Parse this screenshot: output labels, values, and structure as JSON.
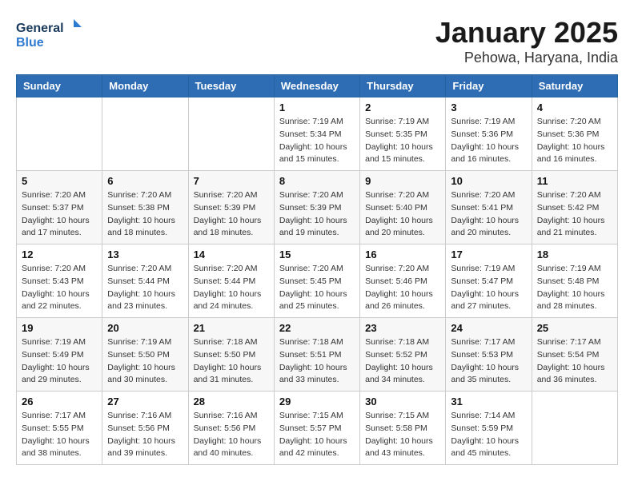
{
  "logo": {
    "line1": "General",
    "line2": "Blue"
  },
  "title": "January 2025",
  "location": "Pehowa, Haryana, India",
  "weekdays": [
    "Sunday",
    "Monday",
    "Tuesday",
    "Wednesday",
    "Thursday",
    "Friday",
    "Saturday"
  ],
  "weeks": [
    [
      {
        "day": "",
        "info": ""
      },
      {
        "day": "",
        "info": ""
      },
      {
        "day": "",
        "info": ""
      },
      {
        "day": "1",
        "info": "Sunrise: 7:19 AM\nSunset: 5:34 PM\nDaylight: 10 hours\nand 15 minutes."
      },
      {
        "day": "2",
        "info": "Sunrise: 7:19 AM\nSunset: 5:35 PM\nDaylight: 10 hours\nand 15 minutes."
      },
      {
        "day": "3",
        "info": "Sunrise: 7:19 AM\nSunset: 5:36 PM\nDaylight: 10 hours\nand 16 minutes."
      },
      {
        "day": "4",
        "info": "Sunrise: 7:20 AM\nSunset: 5:36 PM\nDaylight: 10 hours\nand 16 minutes."
      }
    ],
    [
      {
        "day": "5",
        "info": "Sunrise: 7:20 AM\nSunset: 5:37 PM\nDaylight: 10 hours\nand 17 minutes."
      },
      {
        "day": "6",
        "info": "Sunrise: 7:20 AM\nSunset: 5:38 PM\nDaylight: 10 hours\nand 18 minutes."
      },
      {
        "day": "7",
        "info": "Sunrise: 7:20 AM\nSunset: 5:39 PM\nDaylight: 10 hours\nand 18 minutes."
      },
      {
        "day": "8",
        "info": "Sunrise: 7:20 AM\nSunset: 5:39 PM\nDaylight: 10 hours\nand 19 minutes."
      },
      {
        "day": "9",
        "info": "Sunrise: 7:20 AM\nSunset: 5:40 PM\nDaylight: 10 hours\nand 20 minutes."
      },
      {
        "day": "10",
        "info": "Sunrise: 7:20 AM\nSunset: 5:41 PM\nDaylight: 10 hours\nand 20 minutes."
      },
      {
        "day": "11",
        "info": "Sunrise: 7:20 AM\nSunset: 5:42 PM\nDaylight: 10 hours\nand 21 minutes."
      }
    ],
    [
      {
        "day": "12",
        "info": "Sunrise: 7:20 AM\nSunset: 5:43 PM\nDaylight: 10 hours\nand 22 minutes."
      },
      {
        "day": "13",
        "info": "Sunrise: 7:20 AM\nSunset: 5:44 PM\nDaylight: 10 hours\nand 23 minutes."
      },
      {
        "day": "14",
        "info": "Sunrise: 7:20 AM\nSunset: 5:44 PM\nDaylight: 10 hours\nand 24 minutes."
      },
      {
        "day": "15",
        "info": "Sunrise: 7:20 AM\nSunset: 5:45 PM\nDaylight: 10 hours\nand 25 minutes."
      },
      {
        "day": "16",
        "info": "Sunrise: 7:20 AM\nSunset: 5:46 PM\nDaylight: 10 hours\nand 26 minutes."
      },
      {
        "day": "17",
        "info": "Sunrise: 7:19 AM\nSunset: 5:47 PM\nDaylight: 10 hours\nand 27 minutes."
      },
      {
        "day": "18",
        "info": "Sunrise: 7:19 AM\nSunset: 5:48 PM\nDaylight: 10 hours\nand 28 minutes."
      }
    ],
    [
      {
        "day": "19",
        "info": "Sunrise: 7:19 AM\nSunset: 5:49 PM\nDaylight: 10 hours\nand 29 minutes."
      },
      {
        "day": "20",
        "info": "Sunrise: 7:19 AM\nSunset: 5:50 PM\nDaylight: 10 hours\nand 30 minutes."
      },
      {
        "day": "21",
        "info": "Sunrise: 7:18 AM\nSunset: 5:50 PM\nDaylight: 10 hours\nand 31 minutes."
      },
      {
        "day": "22",
        "info": "Sunrise: 7:18 AM\nSunset: 5:51 PM\nDaylight: 10 hours\nand 33 minutes."
      },
      {
        "day": "23",
        "info": "Sunrise: 7:18 AM\nSunset: 5:52 PM\nDaylight: 10 hours\nand 34 minutes."
      },
      {
        "day": "24",
        "info": "Sunrise: 7:17 AM\nSunset: 5:53 PM\nDaylight: 10 hours\nand 35 minutes."
      },
      {
        "day": "25",
        "info": "Sunrise: 7:17 AM\nSunset: 5:54 PM\nDaylight: 10 hours\nand 36 minutes."
      }
    ],
    [
      {
        "day": "26",
        "info": "Sunrise: 7:17 AM\nSunset: 5:55 PM\nDaylight: 10 hours\nand 38 minutes."
      },
      {
        "day": "27",
        "info": "Sunrise: 7:16 AM\nSunset: 5:56 PM\nDaylight: 10 hours\nand 39 minutes."
      },
      {
        "day": "28",
        "info": "Sunrise: 7:16 AM\nSunset: 5:56 PM\nDaylight: 10 hours\nand 40 minutes."
      },
      {
        "day": "29",
        "info": "Sunrise: 7:15 AM\nSunset: 5:57 PM\nDaylight: 10 hours\nand 42 minutes."
      },
      {
        "day": "30",
        "info": "Sunrise: 7:15 AM\nSunset: 5:58 PM\nDaylight: 10 hours\nand 43 minutes."
      },
      {
        "day": "31",
        "info": "Sunrise: 7:14 AM\nSunset: 5:59 PM\nDaylight: 10 hours\nand 45 minutes."
      },
      {
        "day": "",
        "info": ""
      }
    ]
  ]
}
